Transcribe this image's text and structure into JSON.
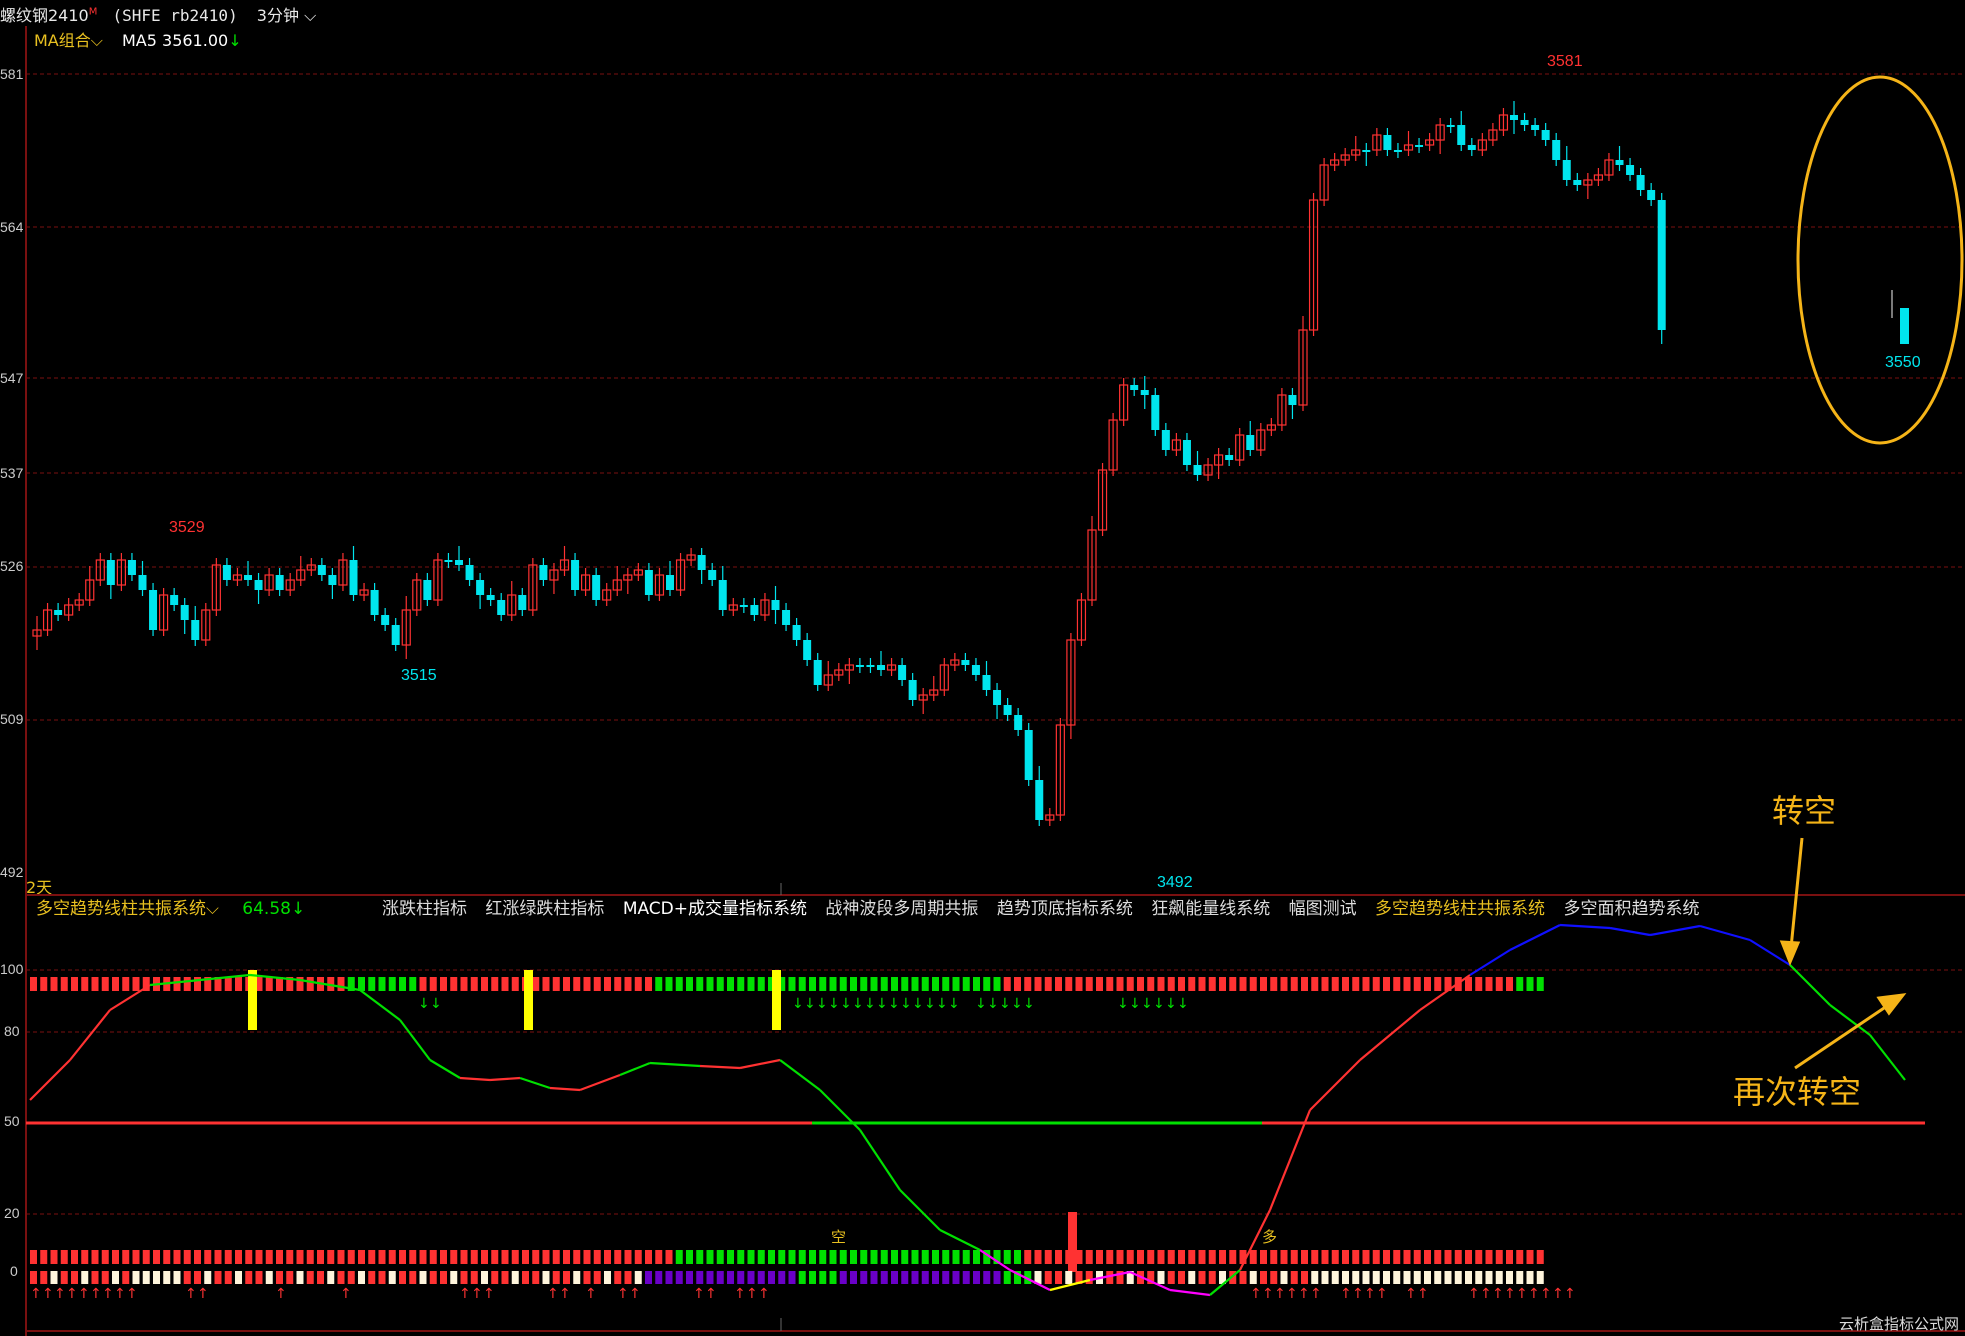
{
  "header": {
    "symbol_name": "螺纹钢2410",
    "symbol_flag": "M",
    "exchange_code": "(SHFE rb2410)",
    "period": "3分钟",
    "ma_group_label": "MA组合",
    "ma5_label": "MA5 3561.00",
    "ma5_arrow": "↓"
  },
  "price_axis": {
    "labels": [
      "581",
      "564",
      "547",
      "537",
      "526",
      "509",
      "492"
    ],
    "days_label": "2天"
  },
  "annotations_price": {
    "high_left": "3529",
    "low_left": "3515",
    "low_mid": "3492",
    "high_right": "3581",
    "last": "3550"
  },
  "indicator": {
    "title": "多空趋势线柱共振系统",
    "value": "64.58",
    "value_arrow": "↓",
    "axis_labels": [
      "100",
      "80",
      "50",
      "20",
      "0"
    ],
    "tabs": [
      "涨跌柱指标",
      "红涨绿跌柱指标",
      "MACD+成交量指标系统",
      "战神波段多周期共振",
      "趋势顶底指标系统",
      "狂飙能量线系统",
      "幅图测试",
      "多空趋势线柱共振系统",
      "多空面积趋势系统"
    ],
    "active_tab": 7,
    "kong_label": "空",
    "duo_label": "多"
  },
  "callouts": {
    "turn_short": "转空",
    "turn_short_again": "再次转空"
  },
  "watermark": "云析盒指标公式网",
  "colors": {
    "up": "#ff3232",
    "down": "#00e5ee",
    "grid": "#7a1010",
    "yellow_label": "#e8c020",
    "annotation": "#f5b418",
    "green": "#00e000",
    "blue": "#1010ff",
    "purple": "#6a00c8",
    "magenta": "#ff00ff"
  }
}
